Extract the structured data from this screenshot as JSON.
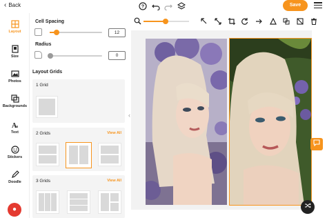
{
  "topbar": {
    "back_label": "Back",
    "save_label": "Save"
  },
  "rail": {
    "items": [
      {
        "label": "Layout",
        "icon": "layout-icon"
      },
      {
        "label": "Size",
        "icon": "size-icon"
      },
      {
        "label": "Photos",
        "icon": "photos-icon"
      },
      {
        "label": "Backgrounds",
        "icon": "backgrounds-icon"
      },
      {
        "label": "Text",
        "icon": "text-icon"
      },
      {
        "label": "Stickers",
        "icon": "stickers-icon"
      },
      {
        "label": "Doodle",
        "icon": "doodle-icon"
      }
    ]
  },
  "panel": {
    "cell_spacing_label": "Cell Spacing",
    "cell_spacing_value": "12",
    "cell_spacing_fraction": 0.1,
    "radius_label": "Radius",
    "radius_value": "0",
    "radius_fraction": 0.0,
    "layout_grids_label": "Layout Grids",
    "grid_groups": [
      {
        "title": "1 Grid",
        "view_all": ""
      },
      {
        "title": "2 Grids",
        "view_all": "View All"
      },
      {
        "title": "3 Grids",
        "view_all": "View All"
      }
    ]
  },
  "zoom": {
    "fraction": 0.45
  },
  "colors": {
    "accent": "#f7941d",
    "help": "#e43a30"
  }
}
